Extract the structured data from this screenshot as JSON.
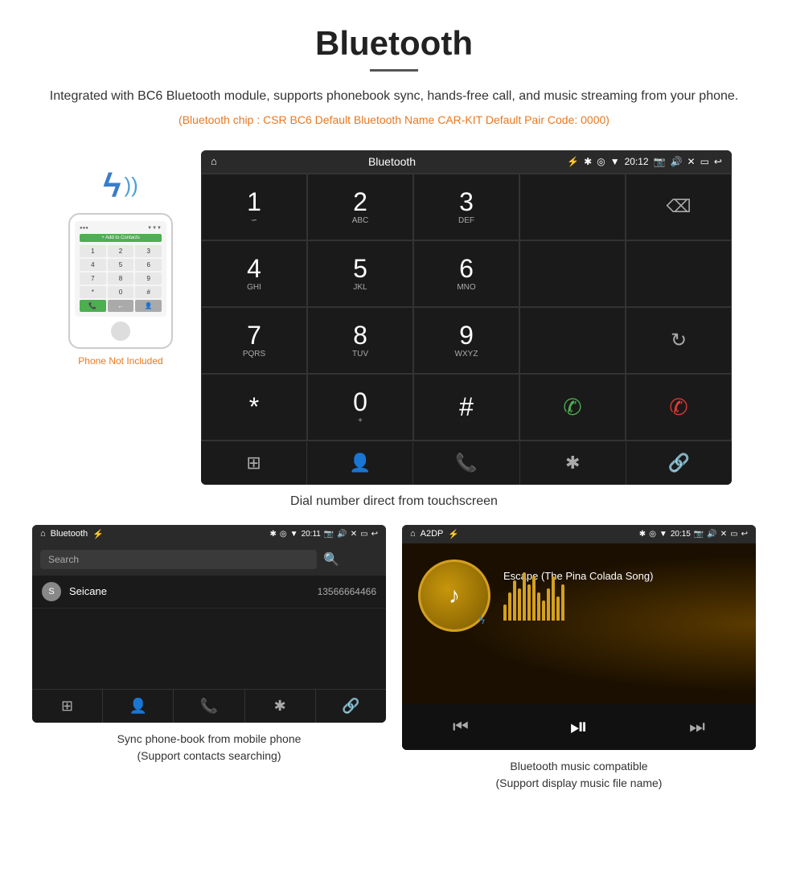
{
  "header": {
    "title": "Bluetooth",
    "description": "Integrated with BC6 Bluetooth module, supports phonebook sync, hands-free call, and music streaming from your phone.",
    "specs": "(Bluetooth chip : CSR BC6    Default Bluetooth Name CAR-KIT    Default Pair Code: 0000)",
    "underline": true
  },
  "phone_label": "Phone Not Included",
  "main_caption": "Dial number direct from touchscreen",
  "car_screen": {
    "status_bar": {
      "home_icon": "⌂",
      "title": "Bluetooth",
      "usb_icon": "⚡",
      "bt_icon": "✱",
      "location_icon": "◎",
      "signal_icon": "▼",
      "time": "20:12",
      "camera_icon": "📷",
      "volume_icon": "🔊",
      "close_icon": "✕",
      "screen_icon": "▭",
      "back_icon": "↩"
    },
    "keypad": [
      {
        "number": "1",
        "letters": "∽",
        "col": 1
      },
      {
        "number": "2",
        "letters": "ABC",
        "col": 2
      },
      {
        "number": "3",
        "letters": "DEF",
        "col": 3
      },
      {
        "number": "",
        "letters": "",
        "col": 4,
        "empty": true
      },
      {
        "number": "",
        "letters": "⌫",
        "col": 5,
        "backspace": true
      },
      {
        "number": "4",
        "letters": "GHI",
        "col": 1
      },
      {
        "number": "5",
        "letters": "JKL",
        "col": 2
      },
      {
        "number": "6",
        "letters": "MNO",
        "col": 3
      },
      {
        "number": "",
        "letters": "",
        "col": 4,
        "empty": true
      },
      {
        "number": "",
        "letters": "",
        "col": 5,
        "empty": true
      },
      {
        "number": "7",
        "letters": "PQRS",
        "col": 1
      },
      {
        "number": "8",
        "letters": "TUV",
        "col": 2
      },
      {
        "number": "9",
        "letters": "WXYZ",
        "col": 3
      },
      {
        "number": "",
        "letters": "",
        "col": 4,
        "empty": true
      },
      {
        "number": "",
        "letters": "↻",
        "col": 5,
        "refresh": true
      },
      {
        "number": "*",
        "letters": "",
        "col": 1
      },
      {
        "number": "0",
        "letters": "+",
        "col": 2
      },
      {
        "number": "#",
        "letters": "",
        "col": 3
      },
      {
        "number": "",
        "letters": "📞",
        "col": 4,
        "call_green": true
      },
      {
        "number": "",
        "letters": "📞",
        "col": 5,
        "call_red": true
      }
    ],
    "nav_items": [
      "⊞",
      "👤",
      "📞",
      "✱",
      "🔗"
    ]
  },
  "phonebook_screen": {
    "status": {
      "home": "⌂",
      "title": "Bluetooth",
      "usb": "⚡",
      "bt": "✱",
      "loc": "◎",
      "sig": "▼",
      "time": "20:11",
      "cam": "📷",
      "vol": "🔊",
      "x": "✕",
      "rect": "▭",
      "back": "↩"
    },
    "search_placeholder": "Search",
    "contacts": [
      {
        "letter": "S",
        "name": "Seicane",
        "number": "13566664466"
      }
    ],
    "nav_items": [
      "⊞",
      "👤",
      "📞",
      "✱",
      "🔗"
    ]
  },
  "music_screen": {
    "status": {
      "home": "⌂",
      "title": "A2DP",
      "usb": "⚡",
      "bt": "✱",
      "loc": "◎",
      "sig": "▼",
      "time": "20:15",
      "cam": "📷",
      "vol": "🔊",
      "x": "✕",
      "rect": "▭",
      "back": "↩"
    },
    "song_title": "Escape (The Pina Colada Song)",
    "eq_bars": [
      20,
      35,
      50,
      40,
      60,
      45,
      55,
      35,
      25,
      40,
      55,
      45,
      30,
      50,
      40,
      35
    ],
    "controls": {
      "prev": "⏮",
      "play_pause": "⏯",
      "next": "⏭"
    }
  },
  "bottom_captions": {
    "left": "Sync phone-book from mobile phone\n(Support contacts searching)",
    "right": "Bluetooth music compatible\n(Support display music file name)"
  }
}
